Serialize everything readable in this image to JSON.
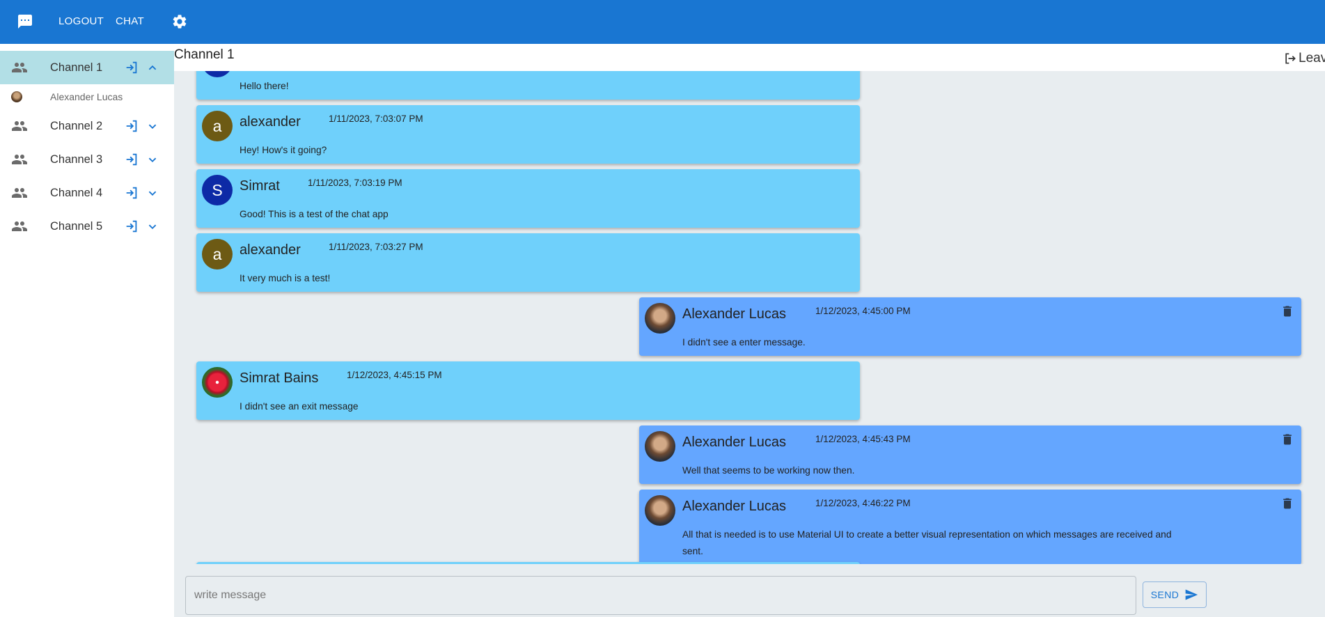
{
  "colors": {
    "appbar": "#1976d2",
    "active_channel": "#b2dfe6",
    "incoming_bubble": "#6fd0fb",
    "outgoing_bubble": "#64a6ff",
    "main_bg": "#e8edf0"
  },
  "appbar": {
    "logo_icon": "chat-bubble-icon",
    "logout_label": "LOGOUT",
    "chat_label": "CHAT",
    "settings_icon": "gear-icon"
  },
  "sidebar": {
    "channels": [
      {
        "label": "Channel 1",
        "expanded": true
      },
      {
        "label": "Channel 2",
        "expanded": false
      },
      {
        "label": "Channel 3",
        "expanded": false
      },
      {
        "label": "Channel 4",
        "expanded": false
      },
      {
        "label": "Channel 5",
        "expanded": false
      }
    ],
    "members": [
      {
        "name": "Alexander Lucas"
      }
    ]
  },
  "channel": {
    "title": "Channel 1",
    "leave_label": "Leave"
  },
  "messages": [
    {
      "side": "left",
      "sender": "",
      "time": "",
      "text": "Hello there!",
      "avatar": ""
    },
    {
      "side": "left",
      "sender": "alexander",
      "time": "1/11/2023, 7:03:07 PM",
      "text": "Hey! How's it going?",
      "avatar": "a"
    },
    {
      "side": "left",
      "sender": "Simrat",
      "time": "1/11/2023, 7:03:19 PM",
      "text": "Good! This is a test of the chat app",
      "avatar": "S"
    },
    {
      "side": "left",
      "sender": "alexander",
      "time": "1/11/2023, 7:03:27 PM",
      "text": "It very much is a test!",
      "avatar": "a"
    },
    {
      "side": "right",
      "sender": "Alexander Lucas",
      "time": "1/12/2023, 4:45:00 PM",
      "text": "I didn't see a enter message.",
      "avatar": "photo"
    },
    {
      "side": "left",
      "sender": "Simrat Bains",
      "time": "1/12/2023, 4:45:15 PM",
      "text": "I didn't see an exit message",
      "avatar": "photo"
    },
    {
      "side": "right",
      "sender": "Alexander Lucas",
      "time": "1/12/2023, 4:45:43 PM",
      "text": "Well that seems to be working now then.",
      "avatar": "photo"
    },
    {
      "side": "right",
      "sender": "Alexander Lucas",
      "time": "1/12/2023, 4:46:22 PM",
      "text": "All that is needed is to use Material UI to create a better visual representation on which messages are received and sent.",
      "avatar": "photo"
    }
  ],
  "composer": {
    "placeholder": "write message",
    "value": "",
    "send_label": "SEND"
  }
}
